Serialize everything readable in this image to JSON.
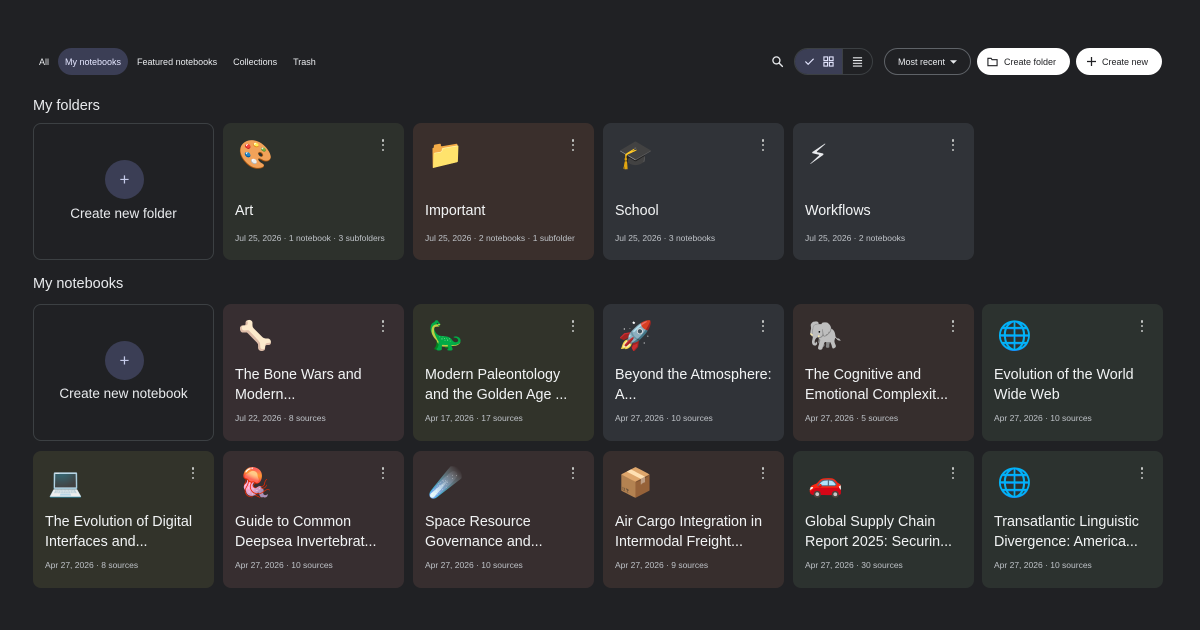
{
  "tabs": [
    {
      "label": "All",
      "active": false
    },
    {
      "label": "My notebooks",
      "active": true
    },
    {
      "label": "Featured notebooks",
      "active": false
    },
    {
      "label": "Collections",
      "active": false
    },
    {
      "label": "Trash",
      "active": false
    }
  ],
  "toolbar": {
    "search_icon": "search-icon",
    "view_toggle": {
      "selected": "grid",
      "icons": [
        "check-icon",
        "grid-icon",
        "list-icon"
      ]
    },
    "sort_label": "Most recent",
    "create_folder_label": "Create folder",
    "create_new_label": "Create new"
  },
  "folders_section": {
    "title": "My folders",
    "create_label": "Create new folder",
    "items": [
      {
        "emoji": "🎨",
        "title": "Art",
        "meta": "Jul 25, 2026 · 1 notebook · 3 subfolders",
        "bg": "#2d312c"
      },
      {
        "emoji": "📁",
        "title": "Important",
        "meta": "Jul 25, 2026 · 2 notebooks · 1 subfolder",
        "bg": "#3a2f2c"
      },
      {
        "emoji": "🎓",
        "title": "School",
        "meta": "Jul 25, 2026 · 3 notebooks",
        "bg": "#303338"
      },
      {
        "emoji": "⚡",
        "title": "Workflows",
        "meta": "Jul 25, 2026 · 2 notebooks",
        "bg": "#303338"
      }
    ]
  },
  "notebooks_section": {
    "title": "My notebooks",
    "create_label": "Create new notebook",
    "items": [
      {
        "emoji": "🦴",
        "title": "The Bone Wars and Modern...",
        "meta": "Jul 22, 2026 · 8 sources",
        "bg": "#372e31"
      },
      {
        "emoji": "🦕",
        "title": "Modern Paleontology and the Golden Age ...",
        "meta": "Apr 17, 2026 · 17 sources",
        "bg": "#31332a"
      },
      {
        "emoji": "🚀",
        "title": "Beyond the Atmosphere: A...",
        "meta": "Apr 27, 2026 · 10 sources",
        "bg": "#303338"
      },
      {
        "emoji": "🐘",
        "title": "The Cognitive and Emotional Complexit...",
        "meta": "Apr 27, 2026 · 5 sources",
        "bg": "#362e2d"
      },
      {
        "emoji": "🌐",
        "title": "Evolution of the World Wide Web",
        "meta": "Apr 27, 2026 · 10 sources",
        "bg": "#2c322f"
      },
      {
        "emoji": "💻",
        "title": "The Evolution of Digital Interfaces and...",
        "meta": "Apr 27, 2026 · 8 sources",
        "bg": "#32332a"
      },
      {
        "emoji": "🪼",
        "title": "Guide to Common Deepsea Invertebrat...",
        "meta": "Apr 27, 2026 · 10 sources",
        "bg": "#372e30"
      },
      {
        "emoji": "☄️",
        "title": "Space Resource Governance and...",
        "meta": "Apr 27, 2026 · 10 sources",
        "bg": "#372e2f"
      },
      {
        "emoji": "📦",
        "title": "Air Cargo Integration in Intermodal Freight...",
        "meta": "Apr 27, 2026 · 9 sources",
        "bg": "#372e2d"
      },
      {
        "emoji": "🚗",
        "title": "Global Supply Chain Report 2025: Securin...",
        "meta": "Apr 27, 2026 · 30 sources",
        "bg": "#2c322f"
      },
      {
        "emoji": "🌐",
        "title": "Transatlantic Linguistic Divergence: America...",
        "meta": "Apr 27, 2026 · 10 sources",
        "bg": "#2c322f"
      }
    ]
  }
}
